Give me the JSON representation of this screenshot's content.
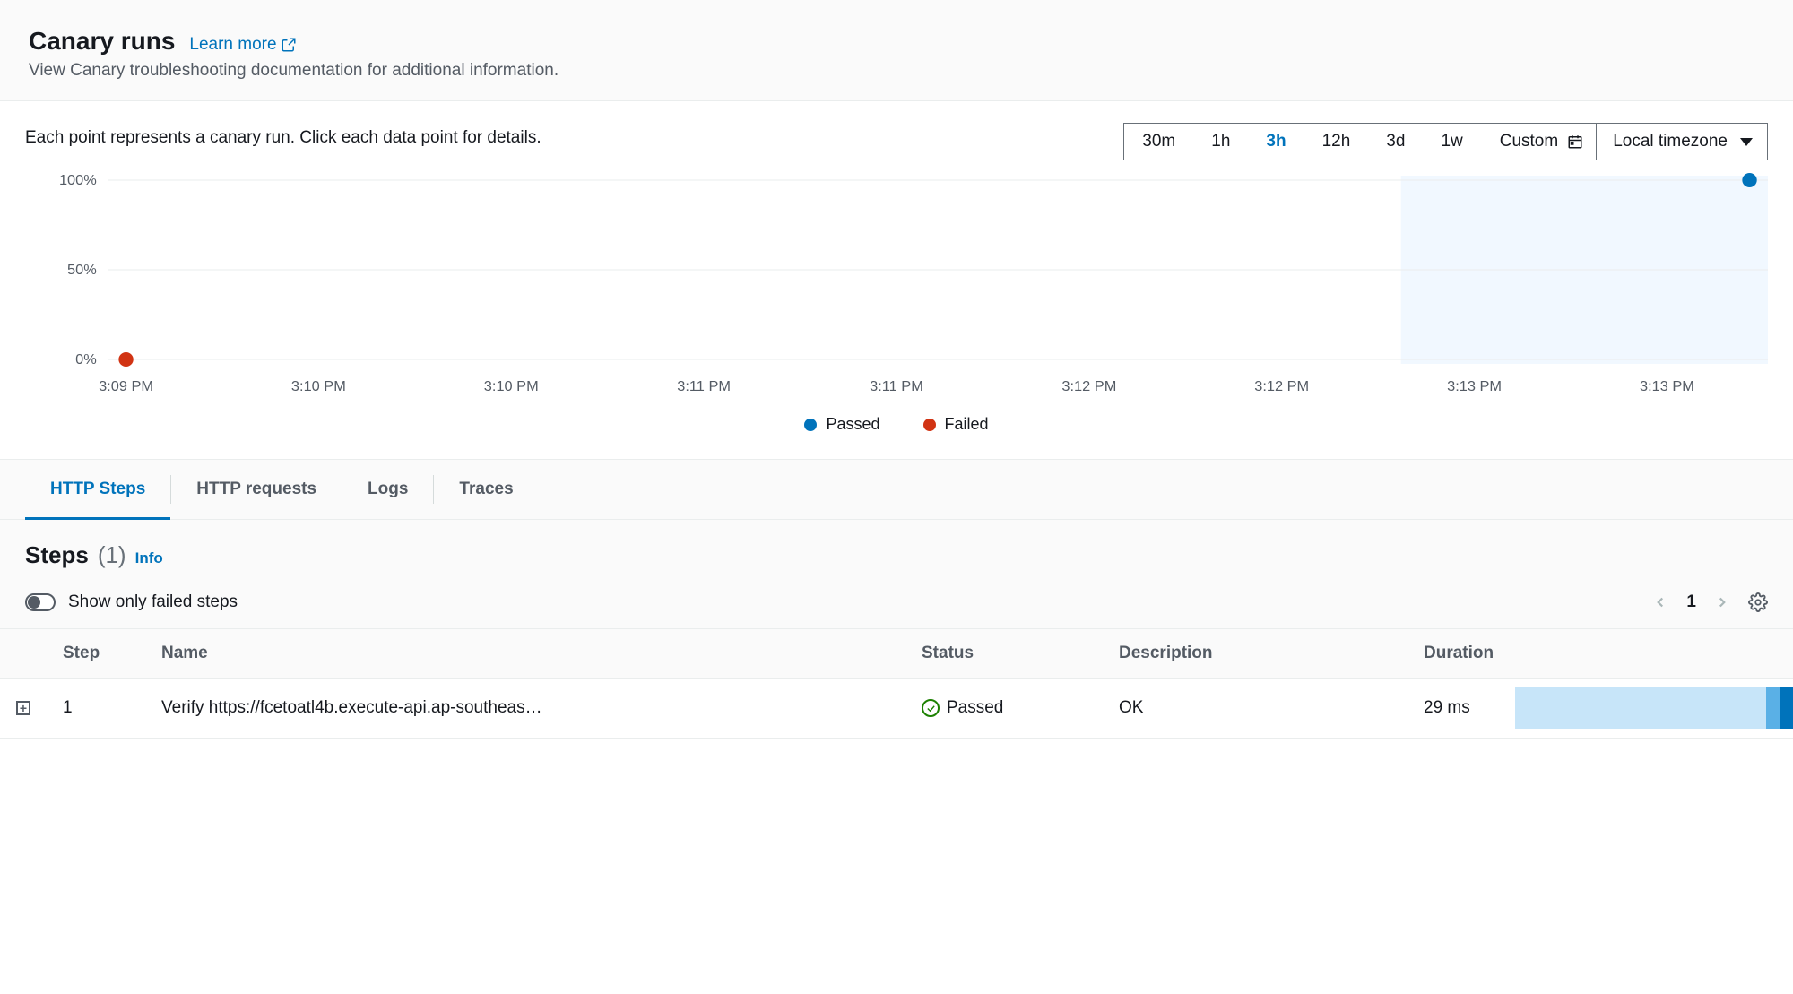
{
  "header": {
    "title": "Canary runs",
    "learn_more": "Learn more",
    "subtitle": "View Canary troubleshooting documentation for additional information."
  },
  "chart": {
    "description": "Each point represents a canary run. Click each data point for details.",
    "time_ranges": [
      "30m",
      "1h",
      "3h",
      "12h",
      "3d",
      "1w"
    ],
    "active_range": "3h",
    "custom_label": "Custom",
    "timezone_label": "Local timezone",
    "legend": {
      "passed": "Passed",
      "failed": "Failed"
    }
  },
  "chart_data": {
    "type": "scatter",
    "title": "",
    "xlabel": "",
    "ylabel": "",
    "ylim": [
      0,
      100
    ],
    "y_ticks": [
      "0%",
      "50%",
      "100%"
    ],
    "x_ticks": [
      "3:09 PM",
      "3:10 PM",
      "3:10 PM",
      "3:11 PM",
      "3:11 PM",
      "3:12 PM",
      "3:12 PM",
      "3:13 PM",
      "3:13 PM"
    ],
    "series": [
      {
        "name": "Passed",
        "color": "#0073bb",
        "points": [
          {
            "x_index": 8.7,
            "y": 100
          }
        ]
      },
      {
        "name": "Failed",
        "color": "#d13313",
        "points": [
          {
            "x_index": 0,
            "y": 0
          }
        ]
      }
    ],
    "selection_region": {
      "x_start_index": 7.3,
      "x_end_index": 9
    }
  },
  "tabs": {
    "items": [
      "HTTP Steps",
      "HTTP requests",
      "Logs",
      "Traces"
    ],
    "active": "HTTP Steps"
  },
  "steps": {
    "title": "Steps",
    "count": "(1)",
    "info": "Info",
    "toggle_label": "Show only failed steps",
    "page": "1",
    "columns": {
      "step": "Step",
      "name": "Name",
      "status": "Status",
      "description": "Description",
      "duration": "Duration"
    },
    "rows": [
      {
        "step": "1",
        "name": "Verify https://fcetoatl4b.execute-api.ap-southeas…",
        "status": "Passed",
        "description": "OK",
        "duration": "29 ms"
      }
    ]
  }
}
